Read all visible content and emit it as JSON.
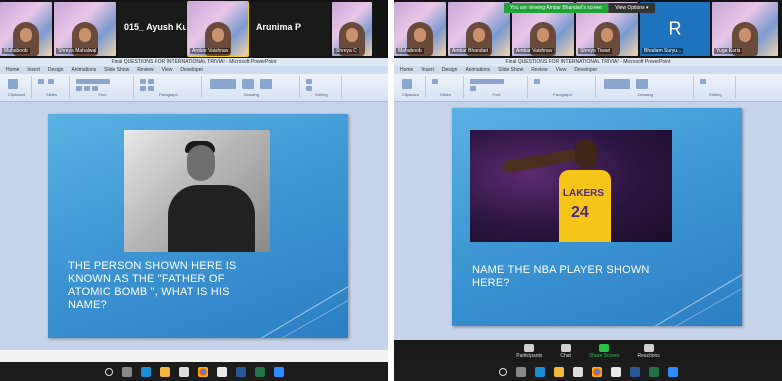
{
  "left": {
    "participants": [
      {
        "name": "Mahaboob",
        "kind": "video"
      },
      {
        "name": "Shreya Mahalwal",
        "kind": "video"
      },
      {
        "name": "015_ Ayush Ku...",
        "kind": "name"
      },
      {
        "name": "Ambar Vaishnav",
        "kind": "video"
      },
      {
        "name": "Arunima P",
        "kind": "name"
      },
      {
        "name": "Shreya C",
        "kind": "video"
      }
    ],
    "window_title": "Final QUESTIONS FOR INTERNATIONAL TRIVIA! - Microsoft PowerPoint",
    "ribbon_tabs": [
      "Home",
      "Insert",
      "Design",
      "Animations",
      "Slide Show",
      "Review",
      "View",
      "Developer"
    ],
    "ribbon_groups": [
      "Clipboard",
      "Slides",
      "Font",
      "Paragraph",
      "Drawing",
      "Editing"
    ],
    "slide_text": "THE PERSON SHOWN HERE IS KNOWN AS THE \"FATHER OF ATOMIC BOMB \", WHAT IS HIS NAME?"
  },
  "right": {
    "banner": {
      "message": "You are viewing Ambar Bhandari's screen",
      "options": "View Options ▾"
    },
    "participants": [
      {
        "name": "Mahaboob",
        "kind": "video"
      },
      {
        "name": "Ambar Bhandari",
        "kind": "video"
      },
      {
        "name": "Ambar Vaishnav",
        "kind": "video"
      },
      {
        "name": "Shreya Tiwari",
        "kind": "video"
      },
      {
        "name": "Bhadam Suryu...",
        "kind": "initial",
        "initial": "R"
      },
      {
        "name": "Yuga Karia",
        "kind": "video"
      }
    ],
    "window_title": "Final QUESTIONS FOR INTERNATIONAL TRIVIA! - Microsoft PowerPoint",
    "slide_text": "NAME THE NBA PLAYER SHOWN HERE?",
    "jersey_text": "LAKERS",
    "jersey_number": "24",
    "controls": [
      {
        "label": "Participants",
        "id": "participants"
      },
      {
        "label": "Chat",
        "id": "chat"
      },
      {
        "label": "Share Screen",
        "id": "share"
      },
      {
        "label": "Reactions",
        "id": "reactions"
      }
    ]
  },
  "taskbar_icons": [
    "start-icon",
    "search-icon",
    "task-view-icon",
    "edge-icon",
    "file-explorer-icon",
    "store-icon",
    "chrome-icon",
    "media-icon",
    "word-icon",
    "excel-icon",
    "powerpoint-icon",
    "zoom-icon"
  ],
  "colors": {
    "slide_blue": "#3f97d4",
    "zoom_green": "#22a33a",
    "taskbar": "#1c1c1c"
  }
}
